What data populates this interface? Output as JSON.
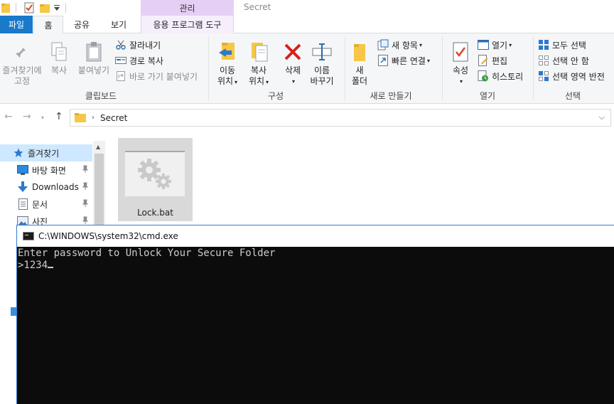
{
  "titlebar": {
    "context_header": "관리",
    "window_title": "Secret"
  },
  "tabs": {
    "file": "파일",
    "home": "홈",
    "share": "공유",
    "view": "보기",
    "app_tools": "응용 프로그램 도구"
  },
  "ribbon": {
    "clipboard": {
      "pin_line1": "즐겨찾기에",
      "pin_line2": "고정",
      "copy": "복사",
      "paste": "붙여넣기",
      "cut": "잘라내기",
      "copy_path": "경로 복사",
      "paste_shortcut": "바로 가기 붙여넣기",
      "group": "클립보드"
    },
    "organize": {
      "move_line1": "이동",
      "move_line2": "위치",
      "copyto_line1": "복사",
      "copyto_line2": "위치",
      "delete": "삭제",
      "rename_line1": "이름",
      "rename_line2": "바꾸기",
      "group": "구성"
    },
    "new": {
      "new_folder_line1": "새",
      "new_folder_line2": "폴더",
      "new_item": "새 항목",
      "easy_access": "빠른 연결",
      "group": "새로 만들기"
    },
    "open": {
      "properties": "속성",
      "open": "열기",
      "edit": "편집",
      "history": "히스토리",
      "group": "열기"
    },
    "select": {
      "select_all": "모두 선택",
      "select_none": "선택 안 함",
      "invert": "선택 영역 반전",
      "group": "선택"
    }
  },
  "address": {
    "path": "Secret"
  },
  "navpane": {
    "items": [
      {
        "label": "즐겨찾기"
      },
      {
        "label": "바탕 화면"
      },
      {
        "label": "Downloads"
      },
      {
        "label": "문서"
      },
      {
        "label": "사진"
      }
    ]
  },
  "files": [
    {
      "name": "Lock.bat"
    }
  ],
  "cmd": {
    "title": "C:\\WINDOWS\\system32\\cmd.exe",
    "line1": "Enter password to Unlock Your Secure Folder",
    "prompt": ">1234"
  },
  "colors": {
    "file_tab": "#1979ca",
    "context_tab": "#e5cff4",
    "selection": "#cde8ff",
    "console_bg": "#0c0c0c",
    "console_fg": "#cccccc"
  }
}
